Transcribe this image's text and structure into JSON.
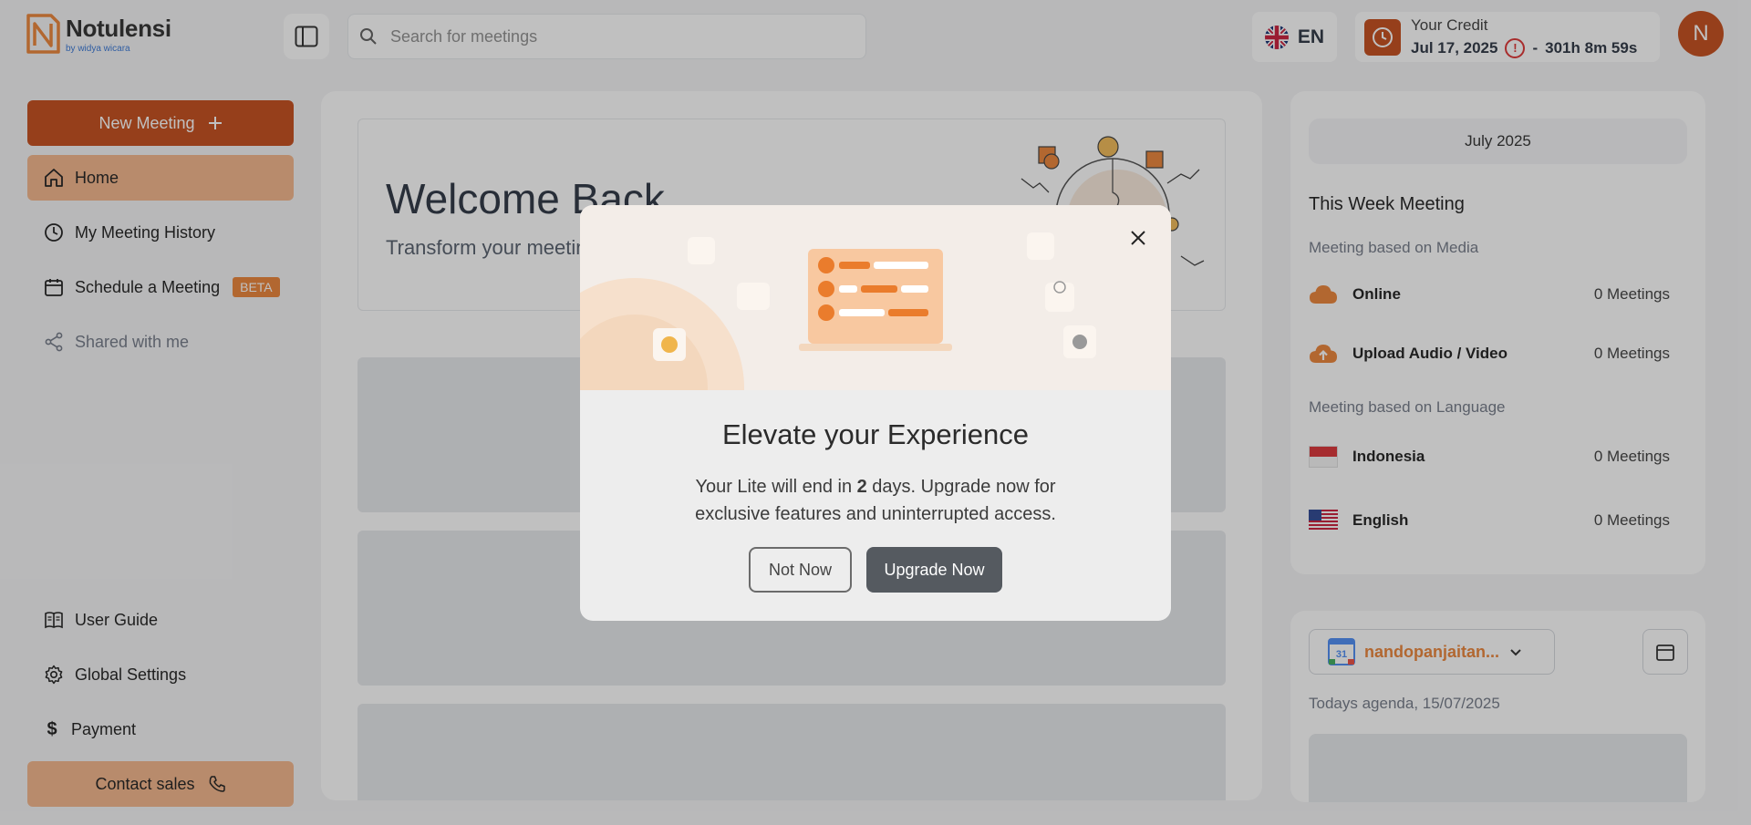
{
  "app": {
    "name": "Notulensi",
    "byline": "by widya wicara"
  },
  "search": {
    "placeholder": "Search for meetings"
  },
  "language": {
    "code": "EN"
  },
  "credit": {
    "label": "Your Credit",
    "date": "Jul 17, 2025",
    "separator": "-",
    "remaining": "301h 8m 59s"
  },
  "user": {
    "initial": "N"
  },
  "sidebar": {
    "new_meeting": "New Meeting",
    "items": [
      {
        "label": "Home",
        "icon": "home-icon",
        "active": true
      },
      {
        "label": "My Meeting History",
        "icon": "clock-icon"
      },
      {
        "label": "Schedule a Meeting",
        "icon": "calendar-icon",
        "badge": "BETA"
      },
      {
        "label": "Shared with me",
        "icon": "share-icon",
        "muted": true
      }
    ],
    "bottom_items": [
      {
        "label": "User Guide",
        "icon": "book-icon"
      },
      {
        "label": "Global Settings",
        "icon": "gear-icon"
      },
      {
        "label": "Payment",
        "icon": "dollar-icon"
      }
    ],
    "contact_sales": "Contact sales"
  },
  "welcome": {
    "title": "Welcome Back",
    "subtitle": "Transform your meetings into insights with Notulensi"
  },
  "right_panel": {
    "month": "July 2025",
    "week_title": "This Week Meeting",
    "media_label": "Meeting based on Media",
    "media": [
      {
        "name": "Online",
        "count": "0 Meetings",
        "icon": "cloud-icon"
      },
      {
        "name": "Upload Audio / Video",
        "count": "0 Meetings",
        "icon": "cloud-upload-icon"
      }
    ],
    "language_label": "Meeting based on Language",
    "languages": [
      {
        "name": "Indonesia",
        "count": "0 Meetings",
        "icon": "indonesia-flag-icon"
      },
      {
        "name": "English",
        "count": "0 Meetings",
        "icon": "us-flag-icon"
      }
    ]
  },
  "calendar_card": {
    "account": "nandopanjaitan...",
    "agenda_label": "Todays agenda, 15/07/2025"
  },
  "modal": {
    "title": "Elevate your Experience",
    "desc_before": "Your Lite will end in ",
    "days": "2",
    "desc_after": " days. Upgrade now for exclusive features and uninterrupted access.",
    "not_now": "Not Now",
    "upgrade": "Upgrade Now"
  },
  "colors": {
    "brand": "#c2410c",
    "brand_light": "#f4b283",
    "accent": "#ea7c2c"
  }
}
